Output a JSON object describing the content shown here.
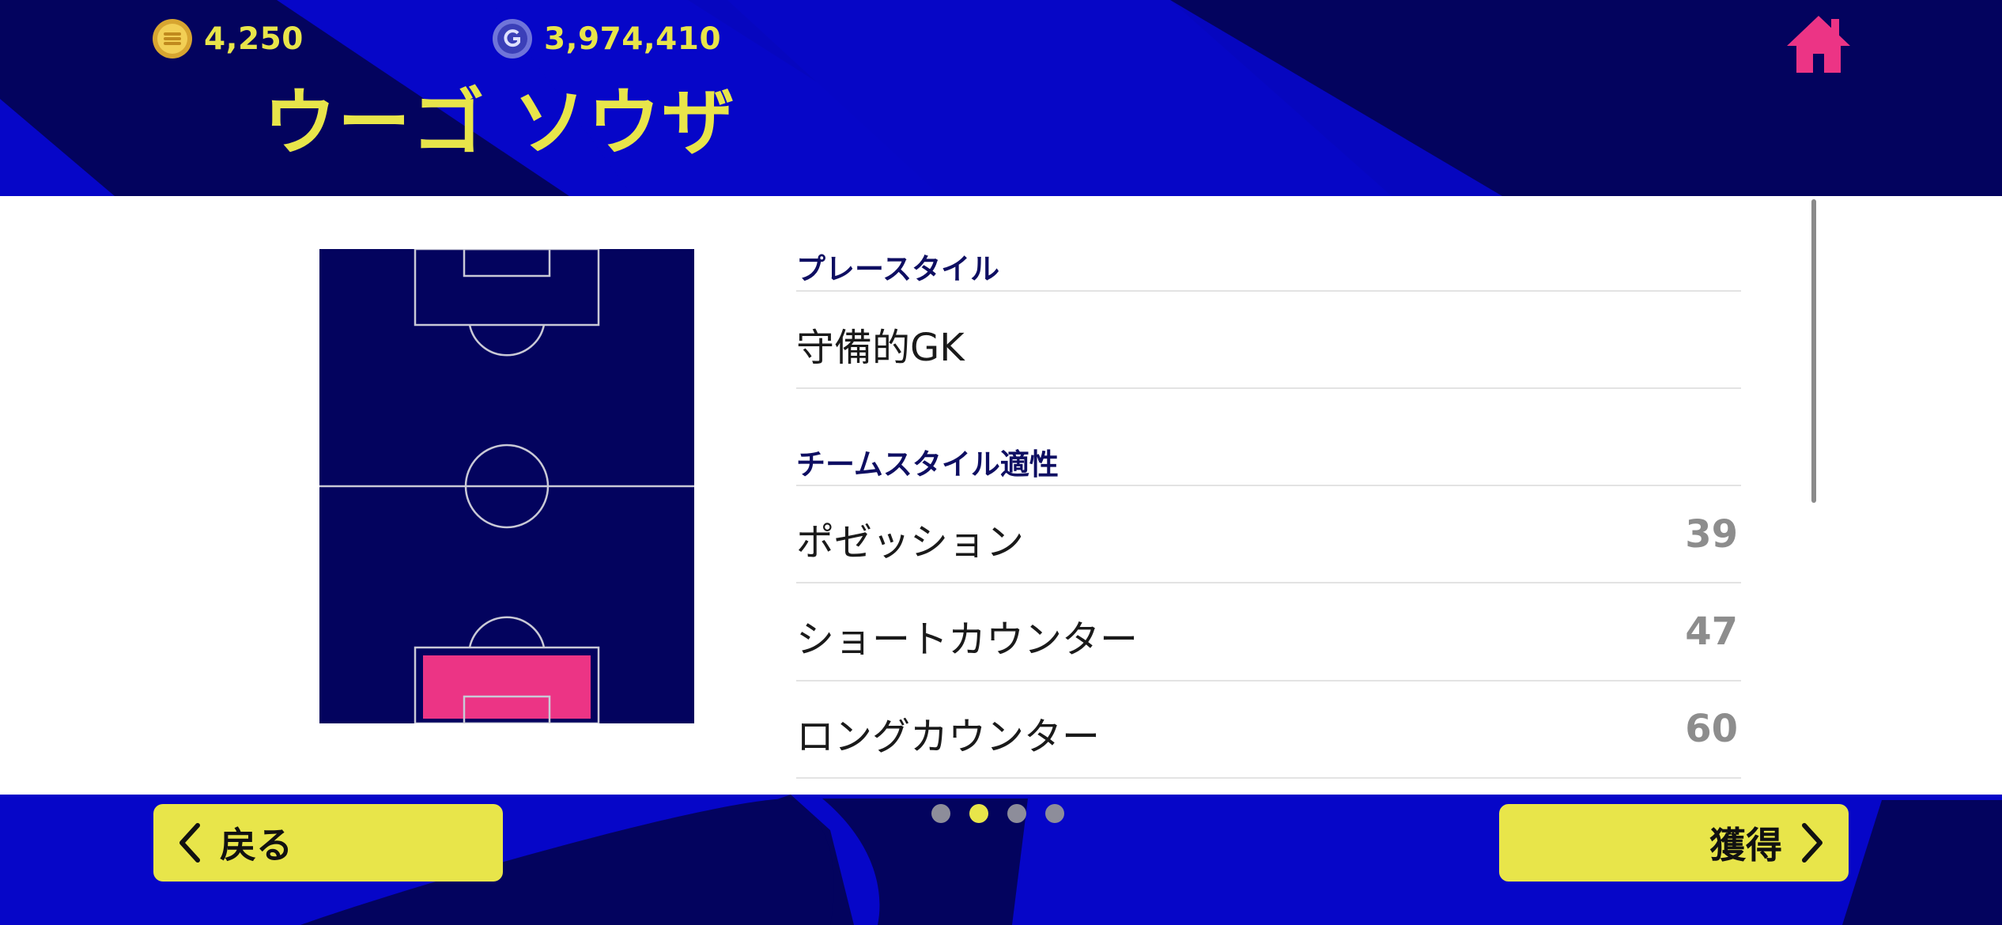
{
  "currency": {
    "coins": {
      "icon": "e-coin-icon",
      "value": "4,250"
    },
    "gp": {
      "icon": "gp-coin-icon",
      "value": "3,974,410"
    }
  },
  "player": {
    "name": "ウーゴ ソウザ"
  },
  "home": {
    "icon": "home-icon"
  },
  "pitch": {
    "highlighted_position": "GK",
    "highlight_color": "#ec3485"
  },
  "playstyle": {
    "title": "プレースタイル",
    "value": "守備的GK"
  },
  "team_style": {
    "title": "チームスタイル適性",
    "rows": [
      {
        "label": "ポゼッション",
        "value": "39"
      },
      {
        "label": "ショートカウンター",
        "value": "47"
      },
      {
        "label": "ロングカウンター",
        "value": "60"
      }
    ]
  },
  "pagination": {
    "total": 4,
    "active": 2
  },
  "footer": {
    "back_label": "戻る",
    "acquire_label": "獲得"
  },
  "colors": {
    "accent_yellow": "#e8e54a",
    "navy": "#03035e",
    "blue": "#0606c8",
    "pink": "#ec3485"
  }
}
